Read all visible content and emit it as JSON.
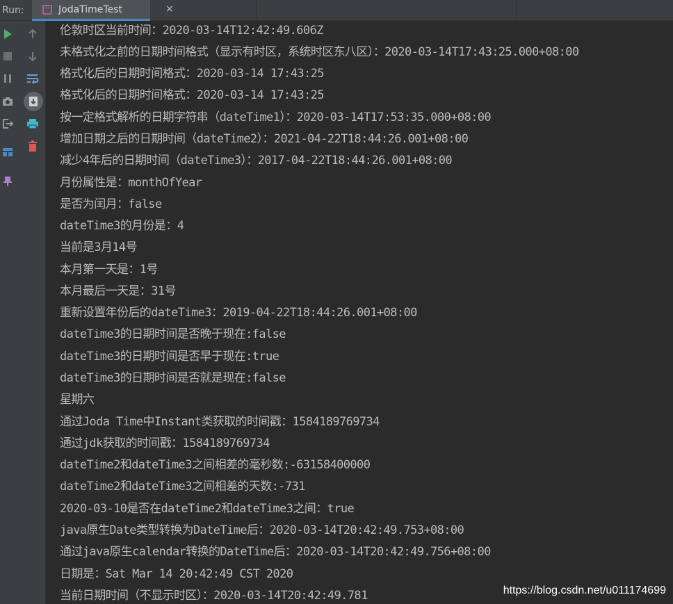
{
  "run_label": "Run:",
  "tab": {
    "title": "JodaTimeTest",
    "close": "×"
  },
  "colors": {
    "background": "#2b2b2b",
    "panel": "#3c3f41",
    "text": "#bbbbbb",
    "run_green": "#59a869",
    "accent_blue": "#4a88c7",
    "print_cyan": "#3fb8d3",
    "trash_red": "#e05555",
    "pin_purple": "#b07cd8"
  },
  "tools": [
    "rerun-play-icon",
    "stop-icon",
    "pause-icon",
    "camera-icon",
    "exit-icon",
    "layout-icon",
    "pin-icon",
    "scroll-up-icon",
    "scroll-down-icon",
    "soft-wrap-icon",
    "scroll-to-end-icon",
    "print-icon",
    "trash-icon"
  ],
  "console_lines": [
    "伦敦时区当前时间：2020-03-14T12:42:49.606Z",
    "未格式化之前的日期时间格式（显示有时区，系统时区东八区）：2020-03-14T17:43:25.000+08:00",
    "格式化后的日期时间格式：2020-03-14 17:43:25",
    "格式化后的日期时间格式：2020-03-14 17:43:25",
    "按一定格式解析的日期字符串（dateTime1）：2020-03-14T17:53:35.000+08:00",
    "增加日期之后的日期时间（dateTime2）：2021-04-22T18:44:26.001+08:00",
    "减少4年后的日期时间（dateTime3）：2017-04-22T18:44:26.001+08:00",
    "月份属性是：monthOfYear",
    "是否为闰月：false",
    "dateTime3的月份是：4",
    "当前是3月14号",
    "本月第一天是：1号",
    "本月最后一天是：31号",
    "重新设置年份后的dateTime3：2019-04-22T18:44:26.001+08:00",
    "dateTime3的日期时间是否晚于现在:false",
    "dateTime3的日期时间是否早于现在:true",
    "dateTime3的日期时间是否就是现在:false",
    "星期六",
    "通过Joda Time中Instant类获取的时间戳：1584189769734",
    "通过jdk获取的时间戳：1584189769734",
    "dateTime2和dateTime3之间相差的毫秒数:-63158400000",
    "dateTime2和dateTime3之间相差的天数:-731",
    "2020-03-10是否在dateTime2和dateTime3之间：true",
    "java原生Date类型转换为DateTime后：2020-03-14T20:42:49.753+08:00",
    "通过java原生calendar转换的DateTime后：2020-03-14T20:42:49.756+08:00",
    "日期是：Sat Mar 14 20:42:49 CST 2020",
    "当前日期时间（不显示时区）：2020-03-14T20:42:49.781"
  ],
  "watermark": "https://blog.csdn.net/u011174699"
}
